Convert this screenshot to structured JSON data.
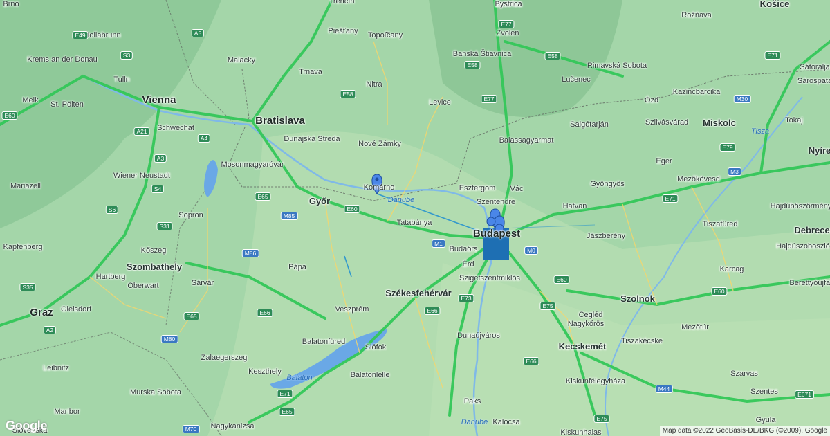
{
  "map": {
    "attribution": "Map data ©2022 GeoBasis-DE/BKG (©2009), Google",
    "logo": "Google",
    "cities_big": [
      {
        "name": "Vienna",
        "k": "vienna"
      },
      {
        "name": "Bratislava",
        "k": "bratislava"
      },
      {
        "name": "Budapest",
        "k": "budapest"
      },
      {
        "name": "Graz",
        "k": "graz"
      }
    ],
    "cities_mid": [
      {
        "name": "Győr",
        "k": "gyor"
      },
      {
        "name": "Székesfehérvár",
        "k": "szekesfehervar"
      },
      {
        "name": "Miskolc",
        "k": "miskolc"
      },
      {
        "name": "Kecskemét",
        "k": "kecskemet"
      },
      {
        "name": "Szolnok",
        "k": "szolnok"
      },
      {
        "name": "Košice",
        "k": "kosice"
      },
      {
        "name": "Szombathely",
        "k": "szombathely"
      },
      {
        "name": "Debrecen",
        "k": "debrecen"
      },
      {
        "name": "Nyíre",
        "k": "nyire"
      }
    ],
    "cities": [
      {
        "name": "Brno",
        "k": "brno"
      },
      {
        "name": "Trenčín",
        "k": "trencin"
      },
      {
        "name": "Bystrica",
        "k": "bystrica"
      },
      {
        "name": "Hollabrunn",
        "k": "hollabrunn"
      },
      {
        "name": "Piešťany",
        "k": "piestany"
      },
      {
        "name": "Topoľčany",
        "k": "topolcany"
      },
      {
        "name": "Zvolen",
        "k": "zvolen"
      },
      {
        "name": "Rožňava",
        "k": "roznava"
      },
      {
        "name": "Krems an der Donau",
        "k": "krems"
      },
      {
        "name": "Malacky",
        "k": "malacky"
      },
      {
        "name": "Banská Štiavnica",
        "k": "stiavnica"
      },
      {
        "name": "Rimavská Sobota",
        "k": "rimavska"
      },
      {
        "name": "Tulln",
        "k": "tulln"
      },
      {
        "name": "Trnava",
        "k": "trnava"
      },
      {
        "name": "Nitra",
        "k": "nitra"
      },
      {
        "name": "Lučenec",
        "k": "lucenec"
      },
      {
        "name": "Sátoralja",
        "k": "satoralja"
      },
      {
        "name": "Sárospata",
        "k": "sarospata"
      },
      {
        "name": "Melk",
        "k": "melk"
      },
      {
        "name": "St. Pölten",
        "k": "stpolten"
      },
      {
        "name": "Levice",
        "k": "levice"
      },
      {
        "name": "Kazincbarcika",
        "k": "kazincbarcika"
      },
      {
        "name": "Ózd",
        "k": "ozd"
      },
      {
        "name": "Schwechat",
        "k": "schwechat"
      },
      {
        "name": "Dunajská Streda",
        "k": "dunajska"
      },
      {
        "name": "Salgótarján",
        "k": "salgotarjan"
      },
      {
        "name": "Szilvásvárad",
        "k": "szilvasvarad"
      },
      {
        "name": "Tokaj",
        "k": "tokaj"
      },
      {
        "name": "Nové Zámky",
        "k": "novezamky"
      },
      {
        "name": "Balassagyarmat",
        "k": "balassagyarmat"
      },
      {
        "name": "Wiener Neustadt",
        "k": "wienerneustadt"
      },
      {
        "name": "Mosonmagyaróvár",
        "k": "mosonmagyarovar"
      },
      {
        "name": "Eger",
        "k": "eger"
      },
      {
        "name": "Mezőkövesd",
        "k": "mezokovesd"
      },
      {
        "name": "Mariazell",
        "k": "mariazell"
      },
      {
        "name": "Komárno",
        "k": "komarno"
      },
      {
        "name": "Esztergom",
        "k": "esztergom"
      },
      {
        "name": "Vác",
        "k": "vac"
      },
      {
        "name": "Gyöngyös",
        "k": "gyongyos"
      },
      {
        "name": "Szentendre",
        "k": "szentendre"
      },
      {
        "name": "Sopron",
        "k": "sopron"
      },
      {
        "name": "Hatvan",
        "k": "hatvan"
      },
      {
        "name": "Hajdúböszörmény",
        "k": "hajduboszormeny"
      },
      {
        "name": "Tatabánya",
        "k": "tatabanya"
      },
      {
        "name": "Tiszafüred",
        "k": "tiszafured"
      },
      {
        "name": "Kapfenberg",
        "k": "kapfenberg"
      },
      {
        "name": "Budaörs",
        "k": "budaors"
      },
      {
        "name": "Jászberény",
        "k": "jaszbereny"
      },
      {
        "name": "Hajdúszoboszló",
        "k": "hajduszoboszlo"
      },
      {
        "name": "Kőszeg",
        "k": "koszeg"
      },
      {
        "name": "Pápa",
        "k": "papa"
      },
      {
        "name": "Érd",
        "k": "erd"
      },
      {
        "name": "Karcag",
        "k": "karcag"
      },
      {
        "name": "Hartberg",
        "k": "hartberg"
      },
      {
        "name": "Oberwart",
        "k": "oberwart"
      },
      {
        "name": "Sárvár",
        "k": "sarvar"
      },
      {
        "name": "Szigetszentmiklós",
        "k": "szigetszentmiklos"
      },
      {
        "name": "Berettyóújfal",
        "k": "berettyo"
      },
      {
        "name": "Gleisdorf",
        "k": "gleisdorf"
      },
      {
        "name": "Veszprém",
        "k": "veszprem"
      },
      {
        "name": "Cegléd",
        "k": "cegled"
      },
      {
        "name": "Nagykőrös",
        "k": "nagykoros"
      },
      {
        "name": "Mezőtúr",
        "k": "mezotur"
      },
      {
        "name": "Tiszakécske",
        "k": "tiszakecske"
      },
      {
        "name": "Dunaújváros",
        "k": "dunaujvaros"
      },
      {
        "name": "Balatonfüred",
        "k": "balatonfured"
      },
      {
        "name": "Siófok",
        "k": "siofok"
      },
      {
        "name": "Leibnitz",
        "k": "leibnitz"
      },
      {
        "name": "Zalaegerszeg",
        "k": "zalaegerszeg"
      },
      {
        "name": "Szarvas",
        "k": "szarvas"
      },
      {
        "name": "Keszthely",
        "k": "keszthely"
      },
      {
        "name": "Balatonlelle",
        "k": "balatonlelle"
      },
      {
        "name": "Kiskunfélegyháza",
        "k": "kiskunfelegyhaza"
      },
      {
        "name": "Murska Sobota",
        "k": "murska"
      },
      {
        "name": "Szentes",
        "k": "szentes"
      },
      {
        "name": "Maribor",
        "k": "maribor"
      },
      {
        "name": "Paks",
        "k": "paks"
      },
      {
        "name": "Gyula",
        "k": "gyula"
      },
      {
        "name": "Slovenska",
        "k": "slovenska"
      },
      {
        "name": "Nagykanizsa",
        "k": "nagykanizsa"
      },
      {
        "name": "Kalocsa",
        "k": "kalocsa"
      },
      {
        "name": "Kiskunhalas",
        "k": "kiskunhalas"
      },
      {
        "name": "Bystrica",
        "k": "bystrica2"
      }
    ],
    "water_labels": [
      {
        "name": "Danube",
        "k": "danube1"
      },
      {
        "name": "Danube",
        "k": "danube2"
      },
      {
        "name": "Balaton",
        "k": "balaton"
      },
      {
        "name": "Tisza",
        "k": "tisza"
      }
    ],
    "road_shields": [
      {
        "name": "E49",
        "k": "e49"
      },
      {
        "name": "A5",
        "k": "a5"
      },
      {
        "name": "E77",
        "k": "e77"
      },
      {
        "name": "E71",
        "k": "e71a"
      },
      {
        "name": "S3",
        "k": "s3"
      },
      {
        "name": "E58",
        "k": "e58a"
      },
      {
        "name": "E58",
        "k": "e58b"
      },
      {
        "name": "E58",
        "k": "e58c"
      },
      {
        "name": "E77",
        "k": "e77b"
      },
      {
        "name": "E60",
        "k": "e60a"
      },
      {
        "name": "A21",
        "k": "a21"
      },
      {
        "name": "A4",
        "k": "a4"
      },
      {
        "name": "M30",
        "k": "m30"
      },
      {
        "name": "A3",
        "k": "a3"
      },
      {
        "name": "E79",
        "k": "e79"
      },
      {
        "name": "S4",
        "k": "s4"
      },
      {
        "name": "M3",
        "k": "m3"
      },
      {
        "name": "E65",
        "k": "e65a"
      },
      {
        "name": "E60",
        "k": "e60b"
      },
      {
        "name": "E71",
        "k": "e71b"
      },
      {
        "name": "S6",
        "k": "s6"
      },
      {
        "name": "M85",
        "k": "m85"
      },
      {
        "name": "S31",
        "k": "s31"
      },
      {
        "name": "M1",
        "k": "m1"
      },
      {
        "name": "M0",
        "k": "m0"
      },
      {
        "name": "M86",
        "k": "m86"
      },
      {
        "name": "E60",
        "k": "e60c"
      },
      {
        "name": "S35",
        "k": "s35"
      },
      {
        "name": "E60",
        "k": "e60d"
      },
      {
        "name": "E73",
        "k": "e73"
      },
      {
        "name": "E75",
        "k": "e75a"
      },
      {
        "name": "E66",
        "k": "e66a"
      },
      {
        "name": "E66",
        "k": "e66b"
      },
      {
        "name": "A2",
        "k": "a2"
      },
      {
        "name": "E65",
        "k": "e65b"
      },
      {
        "name": "M80",
        "k": "m80"
      },
      {
        "name": "E66",
        "k": "e66c"
      },
      {
        "name": "M44",
        "k": "m44"
      },
      {
        "name": "E71",
        "k": "e71c"
      },
      {
        "name": "E671",
        "k": "e671"
      },
      {
        "name": "E75",
        "k": "e75b"
      },
      {
        "name": "M70",
        "k": "m70"
      },
      {
        "name": "E65",
        "k": "e65c"
      }
    ]
  }
}
